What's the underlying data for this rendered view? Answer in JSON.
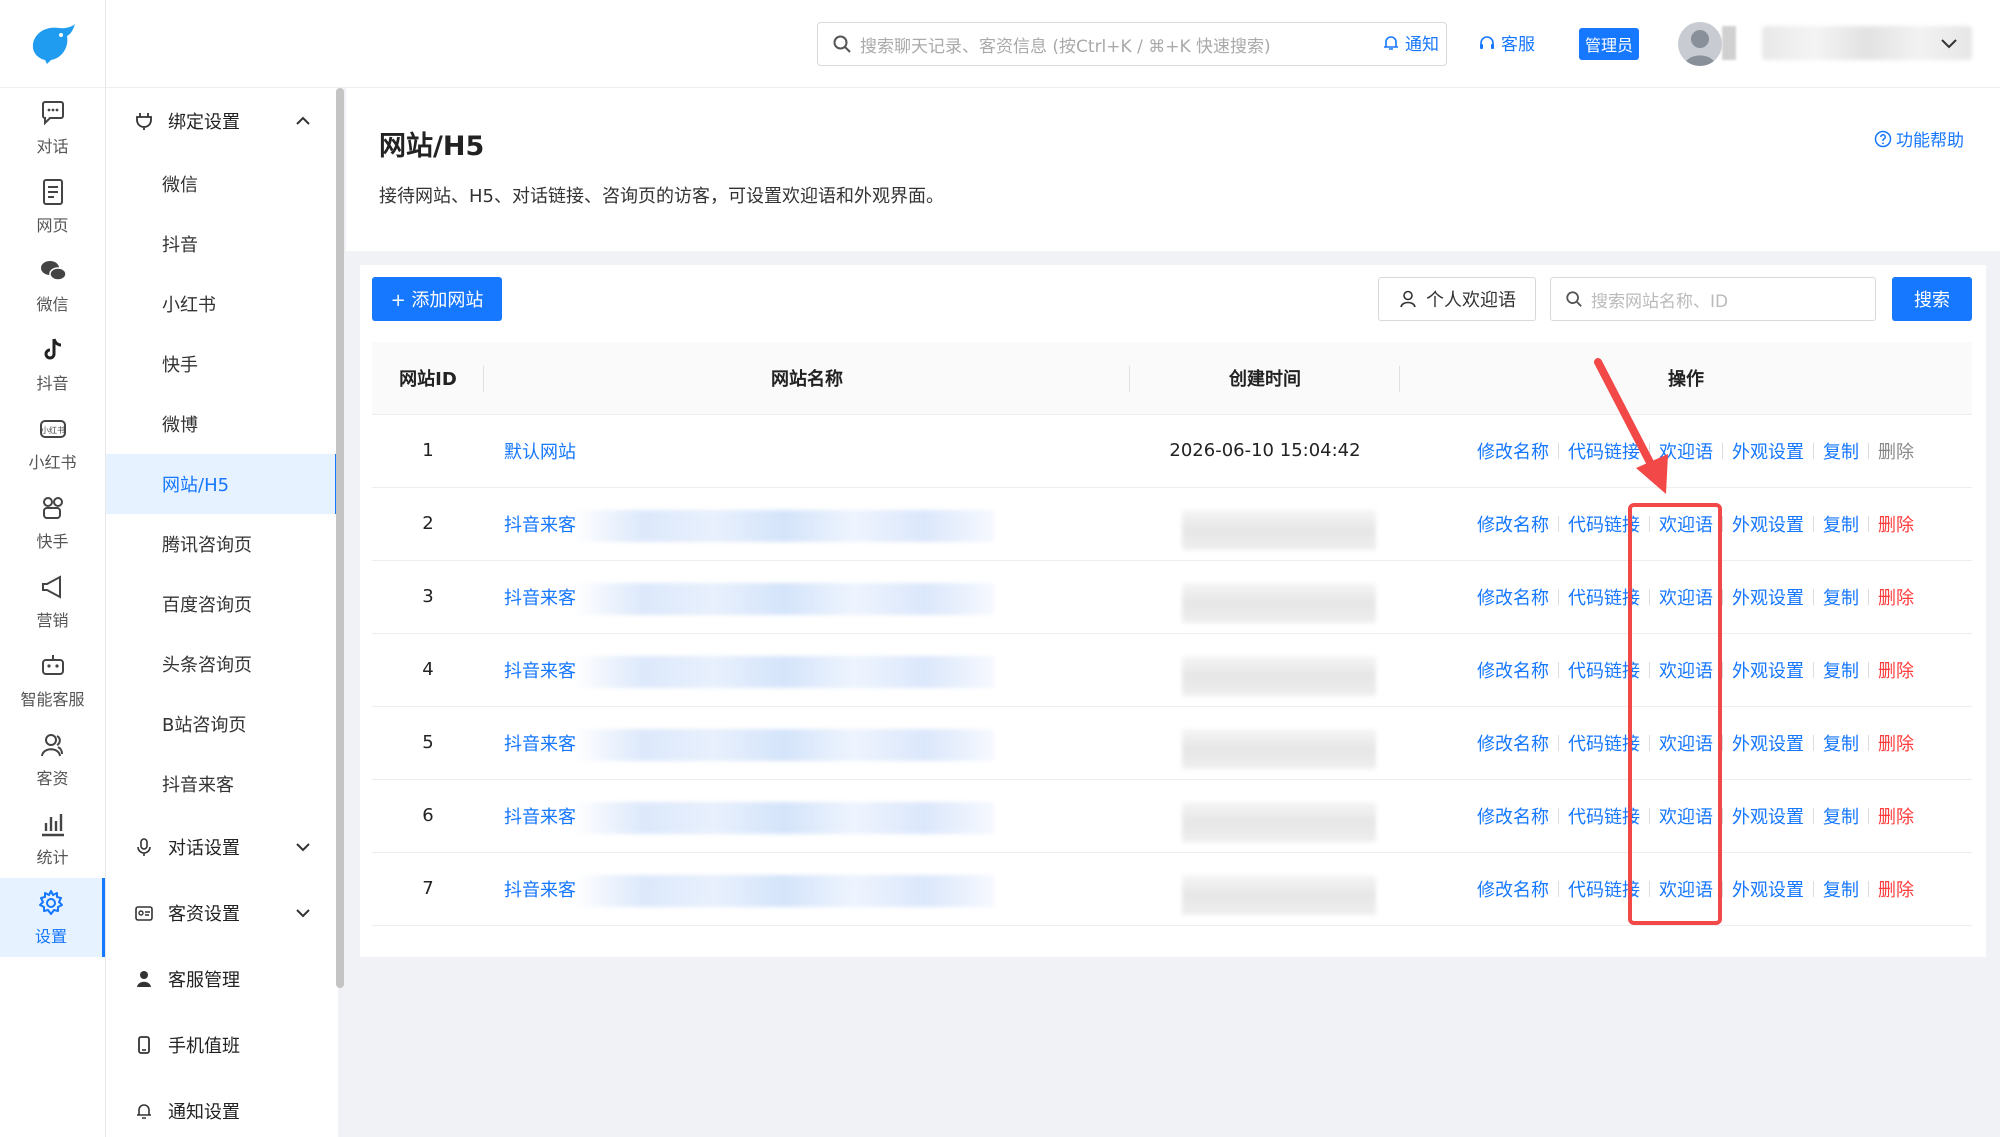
{
  "topbar": {
    "search_placeholder": "搜索聊天记录、客资信息 (按Ctrl+K / ⌘+K 快速搜索)",
    "notify_label": "通知",
    "service_label": "客服",
    "admin_badge": "管理员"
  },
  "leftnav": {
    "items": [
      {
        "label": "对话",
        "icon": "chat-icon"
      },
      {
        "label": "网页",
        "icon": "webpage-icon"
      },
      {
        "label": "微信",
        "icon": "wechat-icon"
      },
      {
        "label": "抖音",
        "icon": "douyin-icon"
      },
      {
        "label": "小红书",
        "icon": "xiaohongshu-icon"
      },
      {
        "label": "快手",
        "icon": "kuaishou-icon"
      },
      {
        "label": "营销",
        "icon": "megaphone-icon"
      },
      {
        "label": "智能客服",
        "icon": "robot-icon"
      },
      {
        "label": "客资",
        "icon": "customers-icon"
      },
      {
        "label": "统计",
        "icon": "stats-icon"
      },
      {
        "label": "设置",
        "icon": "gear-icon",
        "active": true
      }
    ]
  },
  "sidebar": {
    "binding_group": "绑定设置",
    "binding_items": [
      "微信",
      "抖音",
      "小红书",
      "快手",
      "微博",
      "网站/H5",
      "腾讯咨询页",
      "百度咨询页",
      "头条咨询页",
      "B站咨询页",
      "抖音来客"
    ],
    "active_item": "网站/H5",
    "chat_settings": "对话设置",
    "customer_settings": "客资设置",
    "agent_management": "客服管理",
    "mobile_duty": "手机值班",
    "notify_settings": "通知设置"
  },
  "page": {
    "title": "网站/H5",
    "description": "接待网站、H5、对话链接、咨询页的访客，可设置欢迎语和外观界面。",
    "help_label": "功能帮助"
  },
  "toolbar": {
    "add_label": "+ 添加网站",
    "personal_welcome_label": "个人欢迎语",
    "site_search_placeholder": "搜索网站名称、ID",
    "search_label": "搜索"
  },
  "table": {
    "headers": {
      "id": "网站ID",
      "name": "网站名称",
      "created": "创建时间",
      "ops": "操作"
    },
    "rows": [
      {
        "id": "1",
        "name": "默认网站",
        "created": "2026-06-10 15:04:42",
        "blurred": false
      },
      {
        "id": "2",
        "name": "抖音来客",
        "created": "",
        "blurred": true
      },
      {
        "id": "3",
        "name": "抖音来客",
        "created": "",
        "blurred": true
      },
      {
        "id": "4",
        "name": "抖音来客",
        "created": "",
        "blurred": true
      },
      {
        "id": "5",
        "name": "抖音来客",
        "created": "",
        "blurred": true
      },
      {
        "id": "6",
        "name": "抖音来客",
        "created": "",
        "blurred": true
      },
      {
        "id": "7",
        "name": "抖音来客",
        "created": "",
        "blurred": true
      }
    ],
    "ops": {
      "rename": "修改名称",
      "code_link": "代码链接",
      "welcome": "欢迎语",
      "appearance": "外观设置",
      "copy": "复制",
      "delete": "删除"
    }
  },
  "colors": {
    "primary": "#1677ff",
    "danger": "#ff3b3b",
    "highlight": "#f24848"
  }
}
